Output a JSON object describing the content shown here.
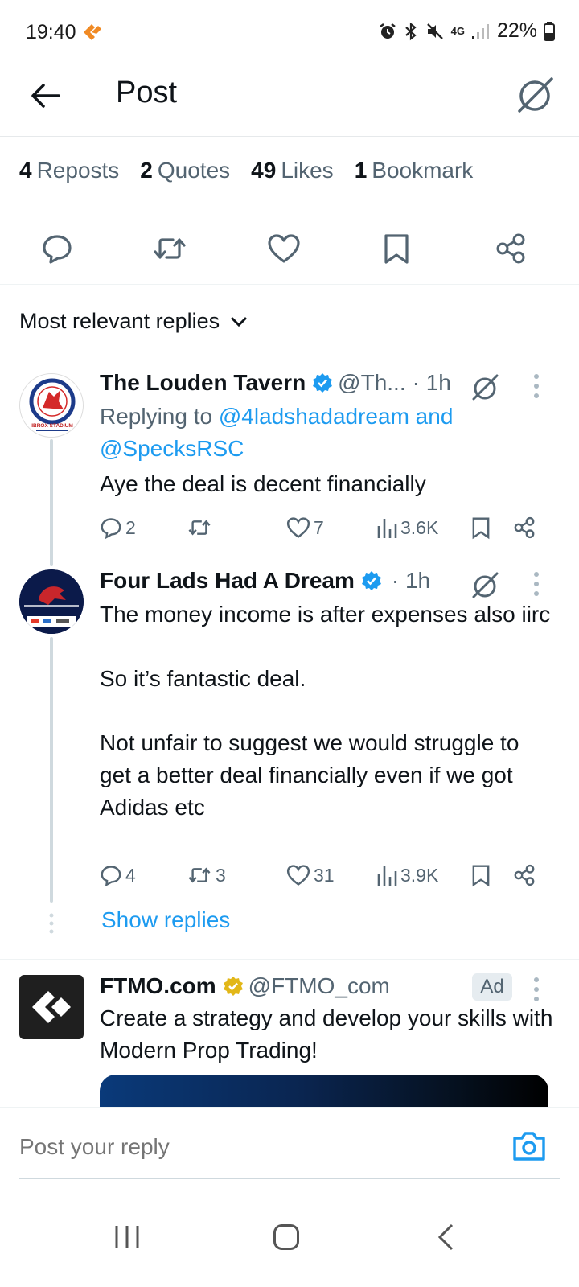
{
  "status_bar": {
    "time": "19:40",
    "network": "4G",
    "battery": "22%",
    "icons": [
      "alarm-icon",
      "bluetooth-icon",
      "mute-icon",
      "signal-icon",
      "battery-icon"
    ]
  },
  "header": {
    "title": "Post",
    "back_icon": "back-arrow-icon",
    "grok_icon": "grok-icon"
  },
  "counts": {
    "reposts_num": "4",
    "reposts_label": "Reposts",
    "quotes_num": "2",
    "quotes_label": "Quotes",
    "likes_num": "49",
    "likes_label": "Likes",
    "bookmarks_num": "1",
    "bookmarks_label": "Bookmark"
  },
  "actions": [
    "reply-icon",
    "repost-icon",
    "like-icon",
    "bookmark-icon",
    "share-icon"
  ],
  "filter": {
    "label": "Most relevant replies"
  },
  "replies": [
    {
      "name": "The Louden Tavern",
      "handle": "@Th...",
      "time": "· 1h",
      "replying_prefix": "Replying to ",
      "replying_to": "@4ladshadadream and @SpecksRSC",
      "text": "Aye the deal is decent financially",
      "stats": {
        "replies": "2",
        "reposts": "",
        "likes": "7",
        "views": "3.6K"
      },
      "avatar_text": "IBROX STADIUM"
    },
    {
      "name": "Four Lads Had A Dream",
      "handle": "",
      "time": "· 1h",
      "text": "The money income is after expenses also iirc\n\nSo it’s fantastic deal.\n\nNot unfair to suggest we would struggle to get a better deal financially even if we got Adidas etc",
      "stats": {
        "replies": "4",
        "reposts": "3",
        "likes": "31",
        "views": "3.9K"
      }
    }
  ],
  "show_replies": "Show replies",
  "ad": {
    "name": "FTMO.com",
    "handle": "@FTMO_com",
    "badge": "Ad",
    "text": "Create a strategy and develop your skills with Modern Prop Trading!"
  },
  "composer": {
    "placeholder": "Post your reply",
    "camera_icon": "camera-icon"
  },
  "navbar": [
    "recent-apps-icon",
    "home-icon",
    "back-icon"
  ],
  "colors": {
    "accent": "#1d9bf0",
    "text": "#0f1419",
    "muted": "#536471",
    "verified_blue": "#1d9bf0",
    "verified_gold": "#e2b719"
  }
}
